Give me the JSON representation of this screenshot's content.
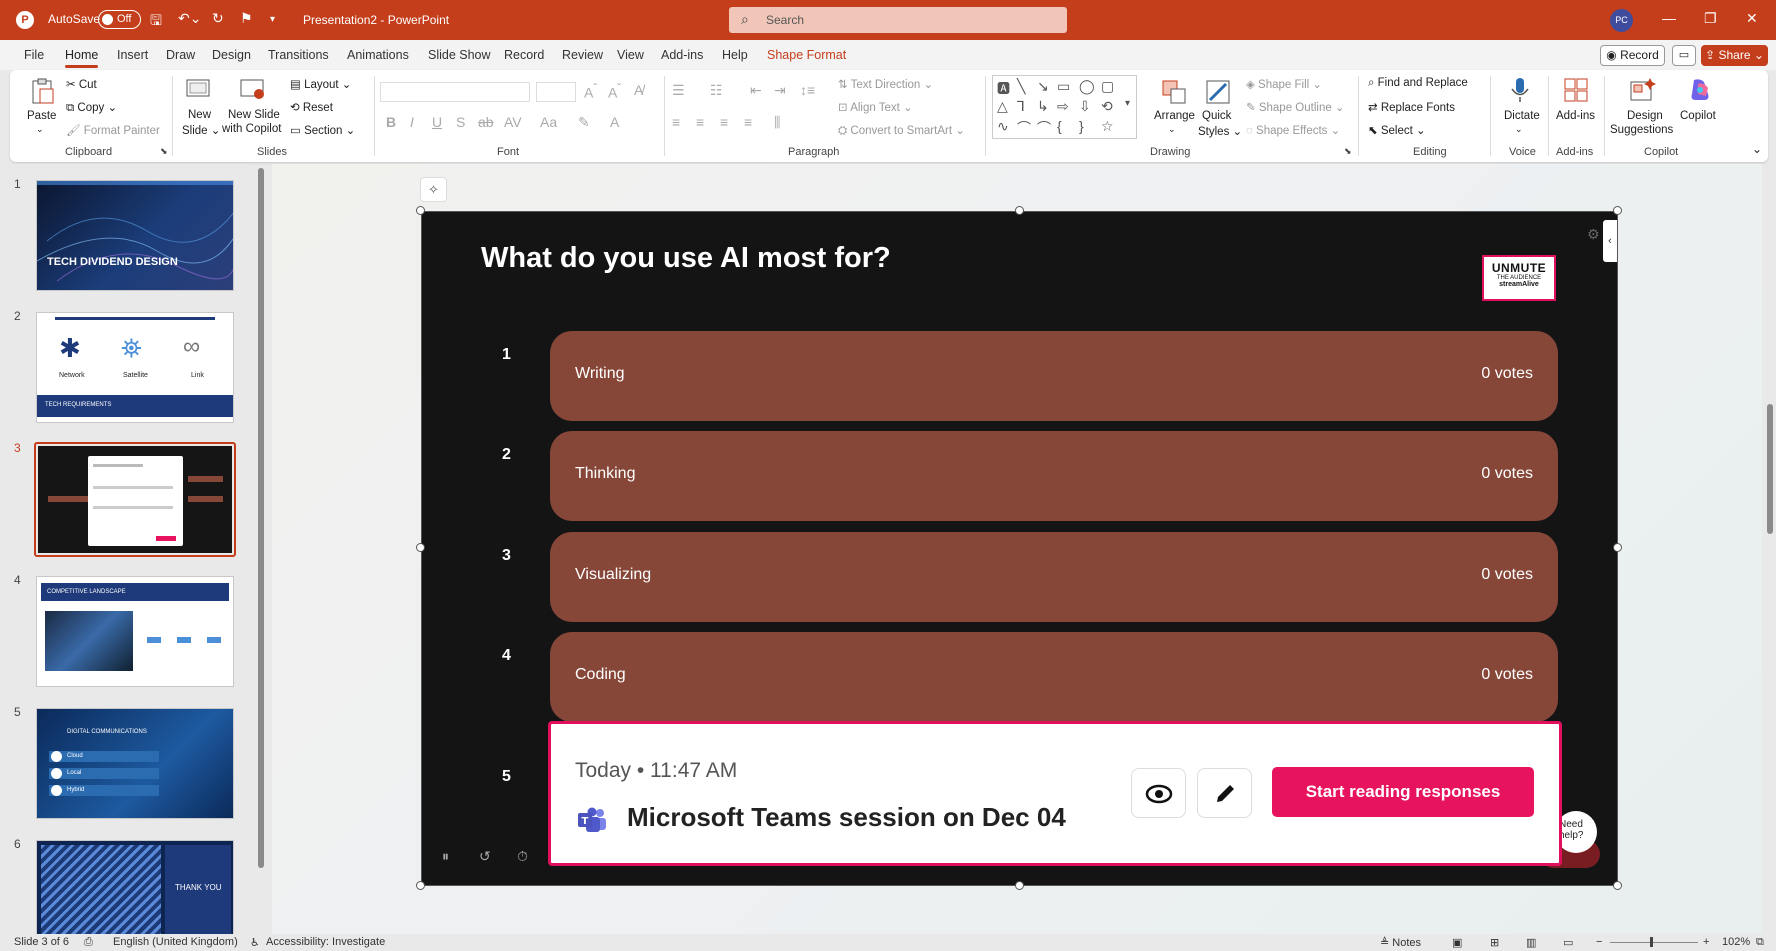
{
  "titlebar": {
    "autosave_label": "AutoSave",
    "autosave_state": "Off",
    "doc_title": "Presentation2 - PowerPoint",
    "search_placeholder": "Search",
    "user_initials": "PC"
  },
  "tabs": [
    "File",
    "Home",
    "Insert",
    "Draw",
    "Design",
    "Transitions",
    "Animations",
    "Slide Show",
    "Record",
    "Review",
    "View",
    "Add-ins",
    "Help",
    "Shape Format"
  ],
  "tab_actions": {
    "record": "Record",
    "share": "Share"
  },
  "ribbon": {
    "clipboard": {
      "paste": "Paste",
      "cut": "Cut",
      "copy": "Copy",
      "format_painter": "Format Painter",
      "label": "Clipboard"
    },
    "slides": {
      "new_slide": "New",
      "new_slide2": "Slide",
      "new_slide_copilot": "New Slide",
      "new_slide_copilot2": "with Copilot",
      "layout": "Layout",
      "reset": "Reset",
      "section": "Section",
      "label": "Slides"
    },
    "font": {
      "label": "Font"
    },
    "paragraph": {
      "text_direction": "Text Direction",
      "align_text": "Align Text",
      "convert_smartart": "Convert to SmartArt",
      "label": "Paragraph"
    },
    "drawing": {
      "arrange": "Arrange",
      "quick_styles": "Quick",
      "quick_styles2": "Styles",
      "shape_fill": "Shape Fill",
      "shape_outline": "Shape Outline",
      "shape_effects": "Shape Effects",
      "label": "Drawing"
    },
    "editing": {
      "find_replace": "Find and Replace",
      "replace_fonts": "Replace Fonts",
      "select": "Select",
      "label": "Editing"
    },
    "voice": {
      "dictate": "Dictate",
      "label": "Voice"
    },
    "addins": {
      "addins": "Add-ins",
      "label": "Add-ins"
    },
    "copilot": {
      "design_suggestions": "Design",
      "design_suggestions2": "Suggestions",
      "copilot": "Copilot",
      "label": "Copilot"
    }
  },
  "thumbnails": [
    {
      "num": "1",
      "caption": "TECH DIVIDEND DESIGN"
    },
    {
      "num": "2",
      "labels": [
        "Network",
        "Satellite",
        "Link"
      ],
      "caption": "TECH REQUIREMENTS"
    },
    {
      "num": "3"
    },
    {
      "num": "4",
      "caption": "COMPETITIVE LANDSCAPE"
    },
    {
      "num": "5",
      "caption": "DIGITAL COMMUNICATIONS",
      "items": [
        "Cloud",
        "Local",
        "Hybrid"
      ]
    },
    {
      "num": "6",
      "caption": "THANK YOU"
    }
  ],
  "slide": {
    "title": "What do you use AI most for?",
    "logo": {
      "line1": "UNMUTE",
      "line2": "THE AUDIENCE",
      "line3": "streamAlive"
    },
    "options": [
      {
        "num": "1",
        "label": "Writing",
        "votes": "0 votes"
      },
      {
        "num": "2",
        "label": "Thinking",
        "votes": "0 votes"
      },
      {
        "num": "3",
        "label": "Visualizing",
        "votes": "0 votes"
      },
      {
        "num": "4",
        "label": "Coding",
        "votes": "0 votes"
      },
      {
        "num": "5"
      }
    ],
    "popup": {
      "time": "Today • 11:47 AM",
      "title": "Microsoft Teams session on Dec 04",
      "start_button": "Start reading responses"
    },
    "help": "Need help?"
  },
  "statusbar": {
    "slide_info": "Slide 3 of 6",
    "language": "English (United Kingdom)",
    "accessibility": "Accessibility: Investigate",
    "notes": "Notes",
    "zoom": "102%"
  },
  "colors": {
    "accent": "#c43e1c",
    "bar": "#864739",
    "pink": "#e8135f"
  }
}
